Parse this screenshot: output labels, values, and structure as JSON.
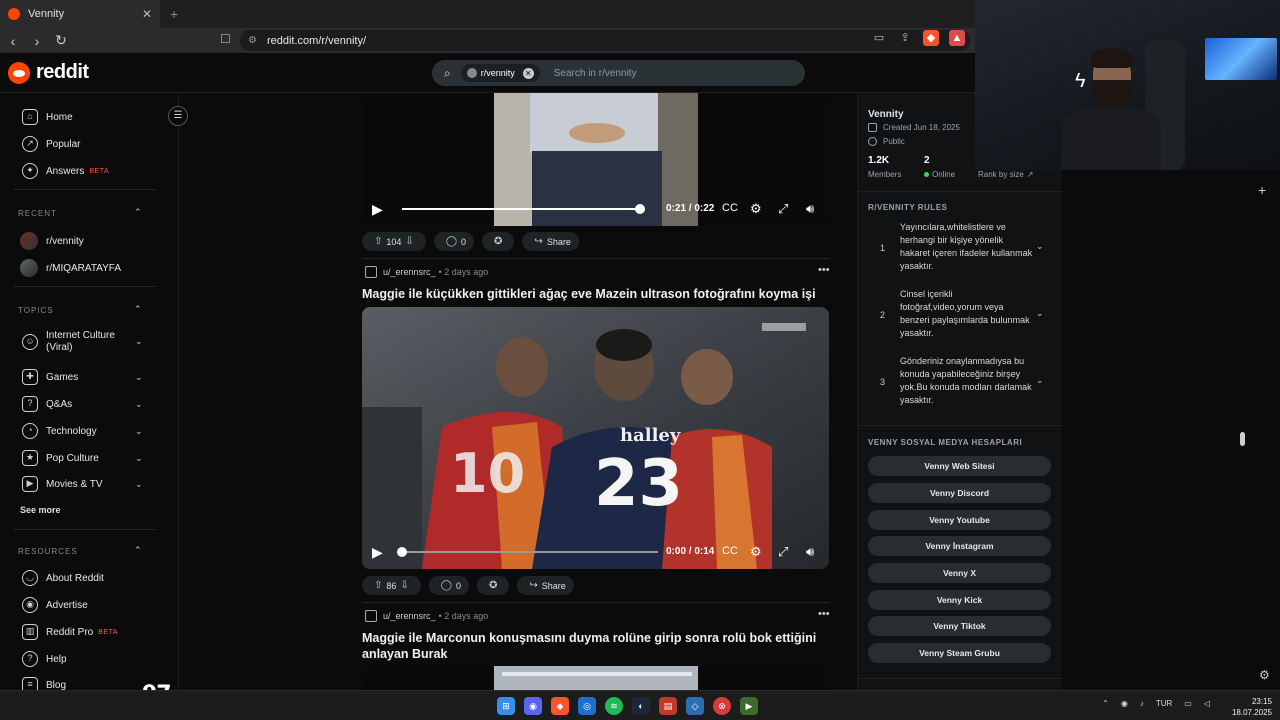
{
  "browser": {
    "tab_title": "Vennity",
    "url": "reddit.com/r/vennity/"
  },
  "header": {
    "logo_text": "reddit",
    "search_chip": "r/vennity",
    "search_placeholder": "Search in r/vennity"
  },
  "left_nav": {
    "main": [
      {
        "label": "Home",
        "icon": "home-icon"
      },
      {
        "label": "Popular",
        "icon": "popular-icon"
      },
      {
        "label": "Answers",
        "icon": "answers-icon",
        "badge": "BETA"
      }
    ],
    "recent_title": "RECENT",
    "recent": [
      "r/vennity",
      "r/MIQARATAYFA"
    ],
    "topics_title": "TOPICS",
    "topics": [
      {
        "label": "Internet Culture (Viral)",
        "line1": "Internet Culture",
        "line2": "(Viral)"
      },
      {
        "label": "Games"
      },
      {
        "label": "Q&As"
      },
      {
        "label": "Technology"
      },
      {
        "label": "Pop Culture"
      },
      {
        "label": "Movies & TV"
      }
    ],
    "see_more": "See more",
    "resources_title": "RESOURCES",
    "resources": [
      {
        "label": "About Reddit"
      },
      {
        "label": "Advertise"
      },
      {
        "label": "Reddit Pro",
        "badge": "BETA"
      },
      {
        "label": "Help"
      },
      {
        "label": "Blog"
      }
    ]
  },
  "feed": {
    "post0": {
      "video_time": "0:21 / 0:22",
      "progress": 0.98,
      "votes": "104",
      "comments": "0",
      "share": "Share"
    },
    "post1": {
      "author": "u/_erennsrc_",
      "time": "2 days ago",
      "title": "Maggie ile küçükken gittikleri ağaç eve Mazein ultrason fotoğrafını koyma işi",
      "video_time": "0:00 / 0:14",
      "progress": 0.0,
      "jersey_numbers": [
        "10",
        "23"
      ],
      "sponsor": "halley",
      "votes": "86",
      "comments": "0",
      "share": "Share"
    },
    "post2": {
      "author": "u/_erennsrc_",
      "time": "2 days ago",
      "title": "Maggie ile Marconun konuşmasını duyma rolüne girip sonra rolü bok ettiğini anlayan Burak"
    }
  },
  "community": {
    "name": "Vennity",
    "created": "Created Jun 18, 2025",
    "visibility": "Public",
    "members_value": "1.2K",
    "members_label": "Members",
    "online_value": "2",
    "online_label": "Online",
    "rank_label": "Rank by size",
    "rules_title": "R/VENNITY RULES",
    "rules": [
      {
        "num": "1",
        "text": "Yayıncılara,whitelistlere ve herhangi bir kişiye yönelik hakaret içeren ifadeler kullanmak yasaktır."
      },
      {
        "num": "2",
        "text": "Cinsel içerikli fotoğraf,video,yorum veya benzeri paylaşımlarda bulunmak yasaktır."
      },
      {
        "num": "3",
        "text": "Gönderiniz onaylanmadıysa bu konuda yapabileceğiniz birşey yok.Bu konuda modları darlamak yasaktır."
      }
    ],
    "social_title": "VENNY SOSYAL MEDYA HESAPLARI",
    "social": [
      "Venny Web Sitesi",
      "Venny Discord",
      "Venny Youtube",
      "Venny İnstagram",
      "Venny X",
      "Venny Kick",
      "Venny Tiktok",
      "Venny Steam Grubu"
    ]
  },
  "overlay_number": "97",
  "taskbar": {
    "lang": "TUR",
    "time": "23:15",
    "date": "18.07.2025"
  },
  "colors": {
    "reddit_orange": "#ff4500",
    "online_green": "#46d160"
  }
}
